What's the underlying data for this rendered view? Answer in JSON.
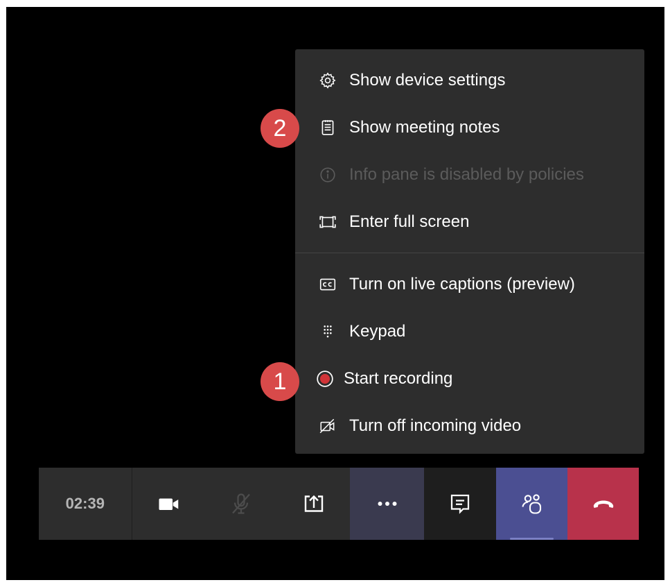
{
  "menu": {
    "items": [
      {
        "label": "Show device settings",
        "icon": "gear-icon",
        "enabled": true
      },
      {
        "label": "Show meeting notes",
        "icon": "notes-icon",
        "enabled": true
      },
      {
        "label": "Info pane is disabled by policies",
        "icon": "info-icon",
        "enabled": false
      },
      {
        "label": "Enter full screen",
        "icon": "fullscreen-icon",
        "enabled": true
      },
      {
        "label": "Turn on live captions (preview)",
        "icon": "captions-icon",
        "enabled": true
      },
      {
        "label": "Keypad",
        "icon": "keypad-icon",
        "enabled": true
      },
      {
        "label": "Start recording",
        "icon": "record-icon",
        "enabled": true
      },
      {
        "label": "Turn off incoming video",
        "icon": "video-off-icon",
        "enabled": true
      }
    ]
  },
  "annotations": {
    "badge_1": "1",
    "badge_2": "2",
    "color": "#d84a4a"
  },
  "toolbar": {
    "timer": "02:39",
    "buttons": [
      {
        "name": "camera",
        "icon": "video-camera-icon"
      },
      {
        "name": "microphone",
        "icon": "mic-muted-icon"
      },
      {
        "name": "share",
        "icon": "share-screen-icon"
      },
      {
        "name": "more",
        "icon": "more-dots-icon"
      },
      {
        "name": "chat",
        "icon": "chat-icon"
      },
      {
        "name": "participants",
        "icon": "people-icon"
      },
      {
        "name": "hang-up",
        "icon": "phone-hangup-icon"
      }
    ]
  },
  "colors": {
    "menu_bg": "#2d2d2d",
    "record_red": "#d13438",
    "hangup_red": "#b8324b",
    "people_active": "#4b4f92"
  }
}
